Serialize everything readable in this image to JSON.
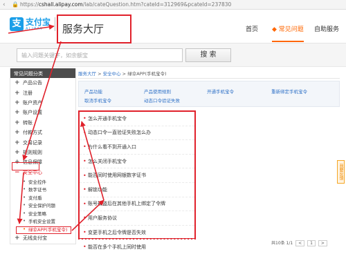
{
  "browser": {
    "back_glyph": "‹",
    "lock_glyph": "🔒",
    "url_prefix": "https://",
    "url_host": "cshall.alipay.com",
    "url_path": "/lab/cateQuestion.htm?cateId=312969&pcateId=237830"
  },
  "header": {
    "logo_mark": "支",
    "logo_cn": "支付宝",
    "logo_en": "ALIPAY",
    "title": "服务大厅",
    "nav": [
      "首页",
      "常见问题",
      "自助服务"
    ],
    "nav_active_index": 1
  },
  "search": {
    "placeholder": "输入问题关键字，如余额宝",
    "button": "搜 索"
  },
  "sidebar": {
    "heading": "常见问题分类",
    "items": [
      {
        "pm": "+",
        "label": "产品公告"
      },
      {
        "pm": "+",
        "label": "注册"
      },
      {
        "pm": "+",
        "label": "账户资产"
      },
      {
        "pm": "+",
        "label": "账户设置"
      },
      {
        "pm": "+",
        "label": "转账"
      },
      {
        "pm": "+",
        "label": "付款方式"
      },
      {
        "pm": "+",
        "label": "交易记录"
      },
      {
        "pm": "+",
        "label": "规则规则"
      },
      {
        "pm": "+",
        "label": "信息保障"
      },
      {
        "pm": "−",
        "label": "安全中心"
      }
    ],
    "active_item_index": 9,
    "sub_items": [
      "安全控件",
      "数字证书",
      "支付盾",
      "安全保护问题",
      "安全策略",
      "手机安全设置",
      "绿伞APP(手机宝令)"
    ],
    "current_sub_index": 6,
    "after_items": [
      {
        "pm": "+",
        "label": "无线支付宝"
      }
    ]
  },
  "breadcrumb": {
    "links": [
      "服务大厅",
      "安全中心"
    ],
    "separator": " > ",
    "current": "绿伞APP(手机宝令)"
  },
  "categories": {
    "row1": [
      "产品功能",
      "产品使用规则",
      "开通手机宝令",
      "重新绑定手机宝令"
    ],
    "row2": [
      "取消手机宝令",
      "动态口令验证失败"
    ]
  },
  "questions": [
    "怎么开通手机宝令",
    "动态口令一直验证失败怎么办",
    "为什么看不到开通入口",
    "怎么关闭手机宝令",
    "能否同时使用网银数字证书",
    "解锁功能",
    "账号被盗后在其他手机上绑定了令牌",
    "用户服务协议",
    "变更手机之后令牌是否失效",
    "能否在多个手机上同时使用"
  ],
  "pager": {
    "info": "共10条 1/1",
    "pages": [
      "<",
      "1",
      ">"
    ]
  },
  "feedback": "我要反馈",
  "colors": {
    "accent": "#1a9ee8",
    "highlight": "#e0202a",
    "active_nav": "#ff6600",
    "link": "#3072c7"
  }
}
